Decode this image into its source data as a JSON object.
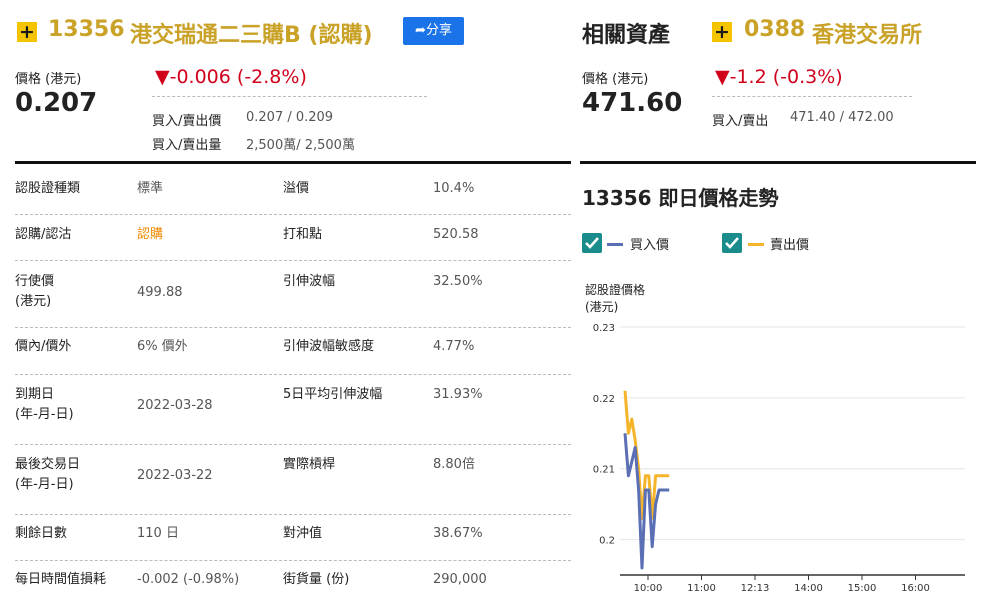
{
  "header": {
    "code": "13356",
    "name": "港交瑞通二三購B (認購)",
    "share_label": "分享"
  },
  "price": {
    "label": "價格 (港元)",
    "value": "0.207",
    "change": "▼-0.006 (-2.8%)",
    "bid_ask_price_label": "買入/賣出價",
    "bid_ask_price_value": "0.207 / 0.209",
    "bid_ask_vol_label": "買入/賣出量",
    "bid_ask_vol_value": "2,500萬/ 2,500萬"
  },
  "related": {
    "title": "相關資產",
    "code": "0388",
    "name": "香港交易所",
    "price_label": "價格 (港元)",
    "price_value": "471.60",
    "change": "▼-1.2 (-0.3%)",
    "bid_ask_label": "買入/賣出",
    "bid_ask_value": "471.40 / 472.00"
  },
  "table": {
    "rows": [
      {
        "l1": "認股證種類",
        "v1": "標準",
        "l2": "溢價",
        "v2": "10.4%"
      },
      {
        "l1": "認購/認沽",
        "v1": "認購",
        "l2": "打和點",
        "v2": "520.58"
      },
      {
        "l1": "行使價\n(港元)",
        "v1": "499.88",
        "l2": "引伸波幅",
        "v2": "32.50%"
      },
      {
        "l1": "價內/價外",
        "v1": "6% 價外",
        "l2": "引伸波幅敏感度",
        "v2": "4.77%"
      },
      {
        "l1": "到期日\n(年-月-日)",
        "v1": "2022-03-28",
        "l2": "5日平均引伸波幅",
        "v2": "31.93%"
      },
      {
        "l1": "最後交易日\n(年-月-日)",
        "v1": "2022-03-22",
        "l2": "實際槓桿",
        "v2": "8.80倍"
      },
      {
        "l1": "剩餘日數",
        "v1": "110 日",
        "l2": "對沖值",
        "v2": "38.67%"
      },
      {
        "l1": "每日時間值損耗",
        "v1": "-0.002 (-0.98%)",
        "l2": "街貨量 (份)",
        "v2": "290,000"
      }
    ]
  },
  "chart_section": {
    "title": "13356 即日價格走勢",
    "legend_bid": "買入價",
    "legend_ask": "賣出價",
    "ylabel_line1": "認股證價格",
    "ylabel_line2": "(港元)"
  },
  "colors": {
    "bid": "#5b6fb5",
    "ask": "#f5b52a",
    "gold": "#c9a227",
    "red": "#d0021b"
  },
  "chart_data": {
    "type": "line",
    "ylabel": "認股證價格 (港元)",
    "ylim": [
      0.195,
      0.23
    ],
    "yticks": [
      "0.23",
      "0.22",
      "0.21",
      "0.2"
    ],
    "xticks": [
      "10:00",
      "11:00",
      "12:13",
      "14:00",
      "15:00",
      "16:00"
    ],
    "series": [
      {
        "name": "買入價",
        "x": [
          0,
          1,
          2,
          3,
          4,
          5,
          6,
          7,
          8,
          9,
          10,
          11,
          12,
          13
        ],
        "y": [
          0.215,
          0.209,
          0.211,
          0.213,
          0.207,
          0.196,
          0.207,
          0.207,
          0.199,
          0.205,
          0.207,
          0.207,
          0.207,
          0.207
        ]
      },
      {
        "name": "賣出價",
        "x": [
          0,
          1,
          2,
          3,
          4,
          5,
          6,
          7,
          8,
          9,
          10,
          11,
          12,
          13
        ],
        "y": [
          0.221,
          0.215,
          0.217,
          0.214,
          0.21,
          0.203,
          0.209,
          0.209,
          0.203,
          0.209,
          0.209,
          0.209,
          0.209,
          0.209
        ]
      }
    ]
  }
}
